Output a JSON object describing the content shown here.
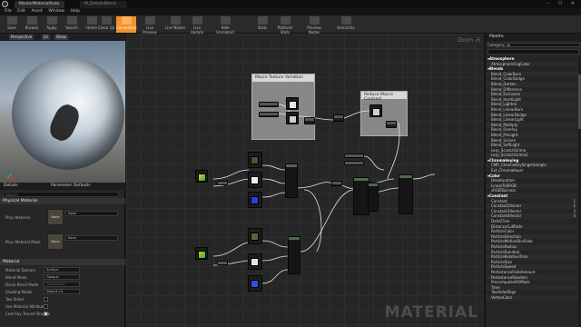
{
  "window": {
    "tabs": [
      "MasterMaterialAuto",
      "M_DetailsBlend"
    ],
    "controls": "–  ☐  ✕"
  },
  "menu": [
    "File",
    "Edit",
    "Asset",
    "Window",
    "Help"
  ],
  "toolbar": [
    {
      "label": "Save",
      "active": false
    },
    {
      "label": "Browse",
      "active": false
    },
    {
      "label": "Apply",
      "active": false
    },
    {
      "label": "Search",
      "active": false
    },
    {
      "label": "Home",
      "active": false
    },
    {
      "label": "Clean Up",
      "active": false
    },
    {
      "label": "Connectors",
      "active": true
    },
    {
      "label": "Live Preview",
      "active": false
    },
    {
      "label": "Live Nodes",
      "active": false
    },
    {
      "label": "Live Update",
      "active": false
    },
    {
      "label": "Hide Unrelated",
      "active": false
    },
    {
      "label": "Stats",
      "active": false
    },
    {
      "label": "Platform Stats",
      "active": false
    },
    {
      "label": "Preview Nodes",
      "active": false
    },
    {
      "label": "Hierarchy",
      "active": false
    }
  ],
  "viewport": {
    "buttons": [
      "Perspective",
      "Lit",
      "Show"
    ]
  },
  "details": {
    "tabs": [
      "Details",
      "Parameter Defaults"
    ],
    "search_placeholder": "Search",
    "sections": {
      "physical_material": "Physical Material",
      "material": "Material"
    },
    "phys_props": [
      {
        "label": "Phys Material",
        "slot": "None",
        "combo": "None"
      },
      {
        "label": "Phys Material Mask",
        "slot": "None",
        "combo": "None"
      }
    ],
    "material_props": [
      {
        "label": "Material Domain",
        "value": "Surface"
      },
      {
        "label": "Blend Mode",
        "value": "Opaque"
      },
      {
        "label": "Decal Blend Mode",
        "value": "Translucent"
      },
      {
        "label": "Shading Model",
        "value": "Default Lit"
      },
      {
        "label": "Two Sided",
        "checked": false
      },
      {
        "label": "Use Material Attributes",
        "checked": false
      },
      {
        "label": "Cast Ray Traced Shadow",
        "checked": true
      }
    ]
  },
  "graph": {
    "zoom_label": "Zoom -6",
    "watermark": "MATERIAL",
    "comments": [
      "Macro Texture Variation",
      "Reduce Macro Contrast"
    ]
  },
  "palette": {
    "title": "Palette",
    "category_label": "Category",
    "category_value": "All",
    "items": [
      {
        "text": "Atmosphere",
        "cat": true
      },
      {
        "text": "AtmosphericFogColor"
      },
      {
        "text": "Blends",
        "cat": true
      },
      {
        "text": "Blend_ColorBurn"
      },
      {
        "text": "Blend_ColorDodge"
      },
      {
        "text": "Blend_Darken"
      },
      {
        "text": "Blend_Difference"
      },
      {
        "text": "Blend_Exclusion"
      },
      {
        "text": "Blend_HardLight"
      },
      {
        "text": "Blend_Lighten"
      },
      {
        "text": "Blend_LinearBurn"
      },
      {
        "text": "Blend_LinearDodge"
      },
      {
        "text": "Blend_LinearLight"
      },
      {
        "text": "Blend_Multiply"
      },
      {
        "text": "Blend_Overlay"
      },
      {
        "text": "Blend_PinLight"
      },
      {
        "text": "Blend_Screen"
      },
      {
        "text": "Blend_SoftLight"
      },
      {
        "text": "Lerp_ScratchGrime"
      },
      {
        "text": "Lerp_ScratchGrime2"
      },
      {
        "text": "Chromakeying",
        "cat": true
      },
      {
        "text": "CMP_ChromaKeySingleSample"
      },
      {
        "text": "Ext_ChromaKeyer"
      },
      {
        "text": "Color",
        "cat": true
      },
      {
        "text": "Desaturation"
      },
      {
        "text": "LinearToSRGB"
      },
      {
        "text": "sRGBToLinear"
      },
      {
        "text": "Constant",
        "cat": true
      },
      {
        "text": "Constant",
        "hotkey": "1"
      },
      {
        "text": "Constant2Vector",
        "hotkey": "2"
      },
      {
        "text": "Constant3Vector",
        "hotkey": "3"
      },
      {
        "text": "Constant4Vector",
        "hotkey": "4"
      },
      {
        "text": "DeltaTime"
      },
      {
        "text": "DistanceCullFade"
      },
      {
        "text": "ParticleColor"
      },
      {
        "text": "ParticleDirection"
      },
      {
        "text": "ParticleMotionBlurFade"
      },
      {
        "text": "ParticleRadius"
      },
      {
        "text": "ParticleRandom"
      },
      {
        "text": "ParticleRelativeTime"
      },
      {
        "text": "ParticleSize"
      },
      {
        "text": "ParticleSpeed"
      },
      {
        "text": "PerInstanceFadeAmount"
      },
      {
        "text": "PerInstanceRandom"
      },
      {
        "text": "PrecomputedAOMask"
      },
      {
        "text": "Time"
      },
      {
        "text": "TwoSidedSign"
      },
      {
        "text": "VertexColor"
      }
    ]
  }
}
